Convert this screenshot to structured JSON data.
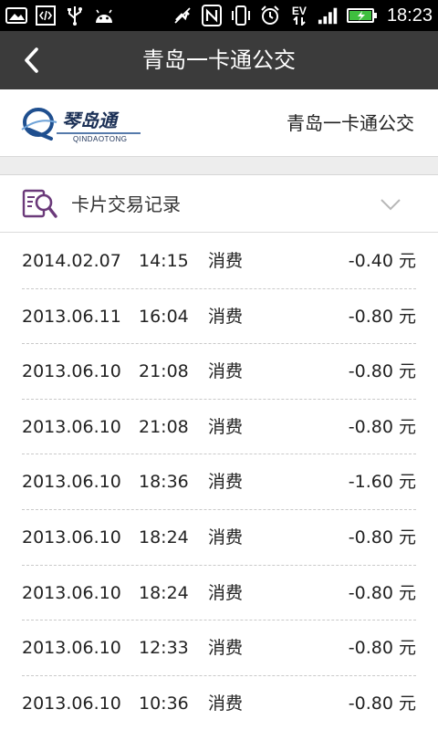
{
  "statusbar": {
    "time": "18:23",
    "ev_label": "EV",
    "left_icons": [
      "gallery-icon",
      "code-icon",
      "usb-icon",
      "android-icon"
    ],
    "right_icons": [
      "mute-icon",
      "nfc-icon",
      "vibrate-icon",
      "alarm-icon",
      "ev-data-icon",
      "signal-icon",
      "battery-charging-icon"
    ]
  },
  "header": {
    "title": "青岛一卡通公交",
    "back_icon": "chevron-left-icon"
  },
  "brand": {
    "logo_text": "琴岛通",
    "logo_subtext": "QINDAOTONG",
    "name": "青岛一卡通公交"
  },
  "section": {
    "title": "卡片交易记录",
    "icon": "document-search-icon",
    "toggle_icon": "chevron-down-icon"
  },
  "records": [
    {
      "date": "2014.02.07",
      "time": "14:15",
      "type": "消费",
      "amount": "-0.40 元"
    },
    {
      "date": "2013.06.11",
      "time": "16:04",
      "type": "消费",
      "amount": "-0.80 元"
    },
    {
      "date": "2013.06.10",
      "time": "21:08",
      "type": "消费",
      "amount": "-0.80 元"
    },
    {
      "date": "2013.06.10",
      "time": "21:08",
      "type": "消费",
      "amount": "-0.80 元"
    },
    {
      "date": "2013.06.10",
      "time": "18:36",
      "type": "消费",
      "amount": "-1.60 元"
    },
    {
      "date": "2013.06.10",
      "time": "18:24",
      "type": "消费",
      "amount": "-0.80 元"
    },
    {
      "date": "2013.06.10",
      "time": "18:24",
      "type": "消费",
      "amount": "-0.80 元"
    },
    {
      "date": "2013.06.10",
      "time": "12:33",
      "type": "消费",
      "amount": "-0.80 元"
    },
    {
      "date": "2013.06.10",
      "time": "10:36",
      "type": "消费",
      "amount": "-0.80 元"
    }
  ],
  "colors": {
    "statusbar_bg": "#000000",
    "titlebar_bg": "#3b3b3b",
    "logo_blue": "#1f4f8f",
    "section_icon": "#6b3a7a"
  }
}
